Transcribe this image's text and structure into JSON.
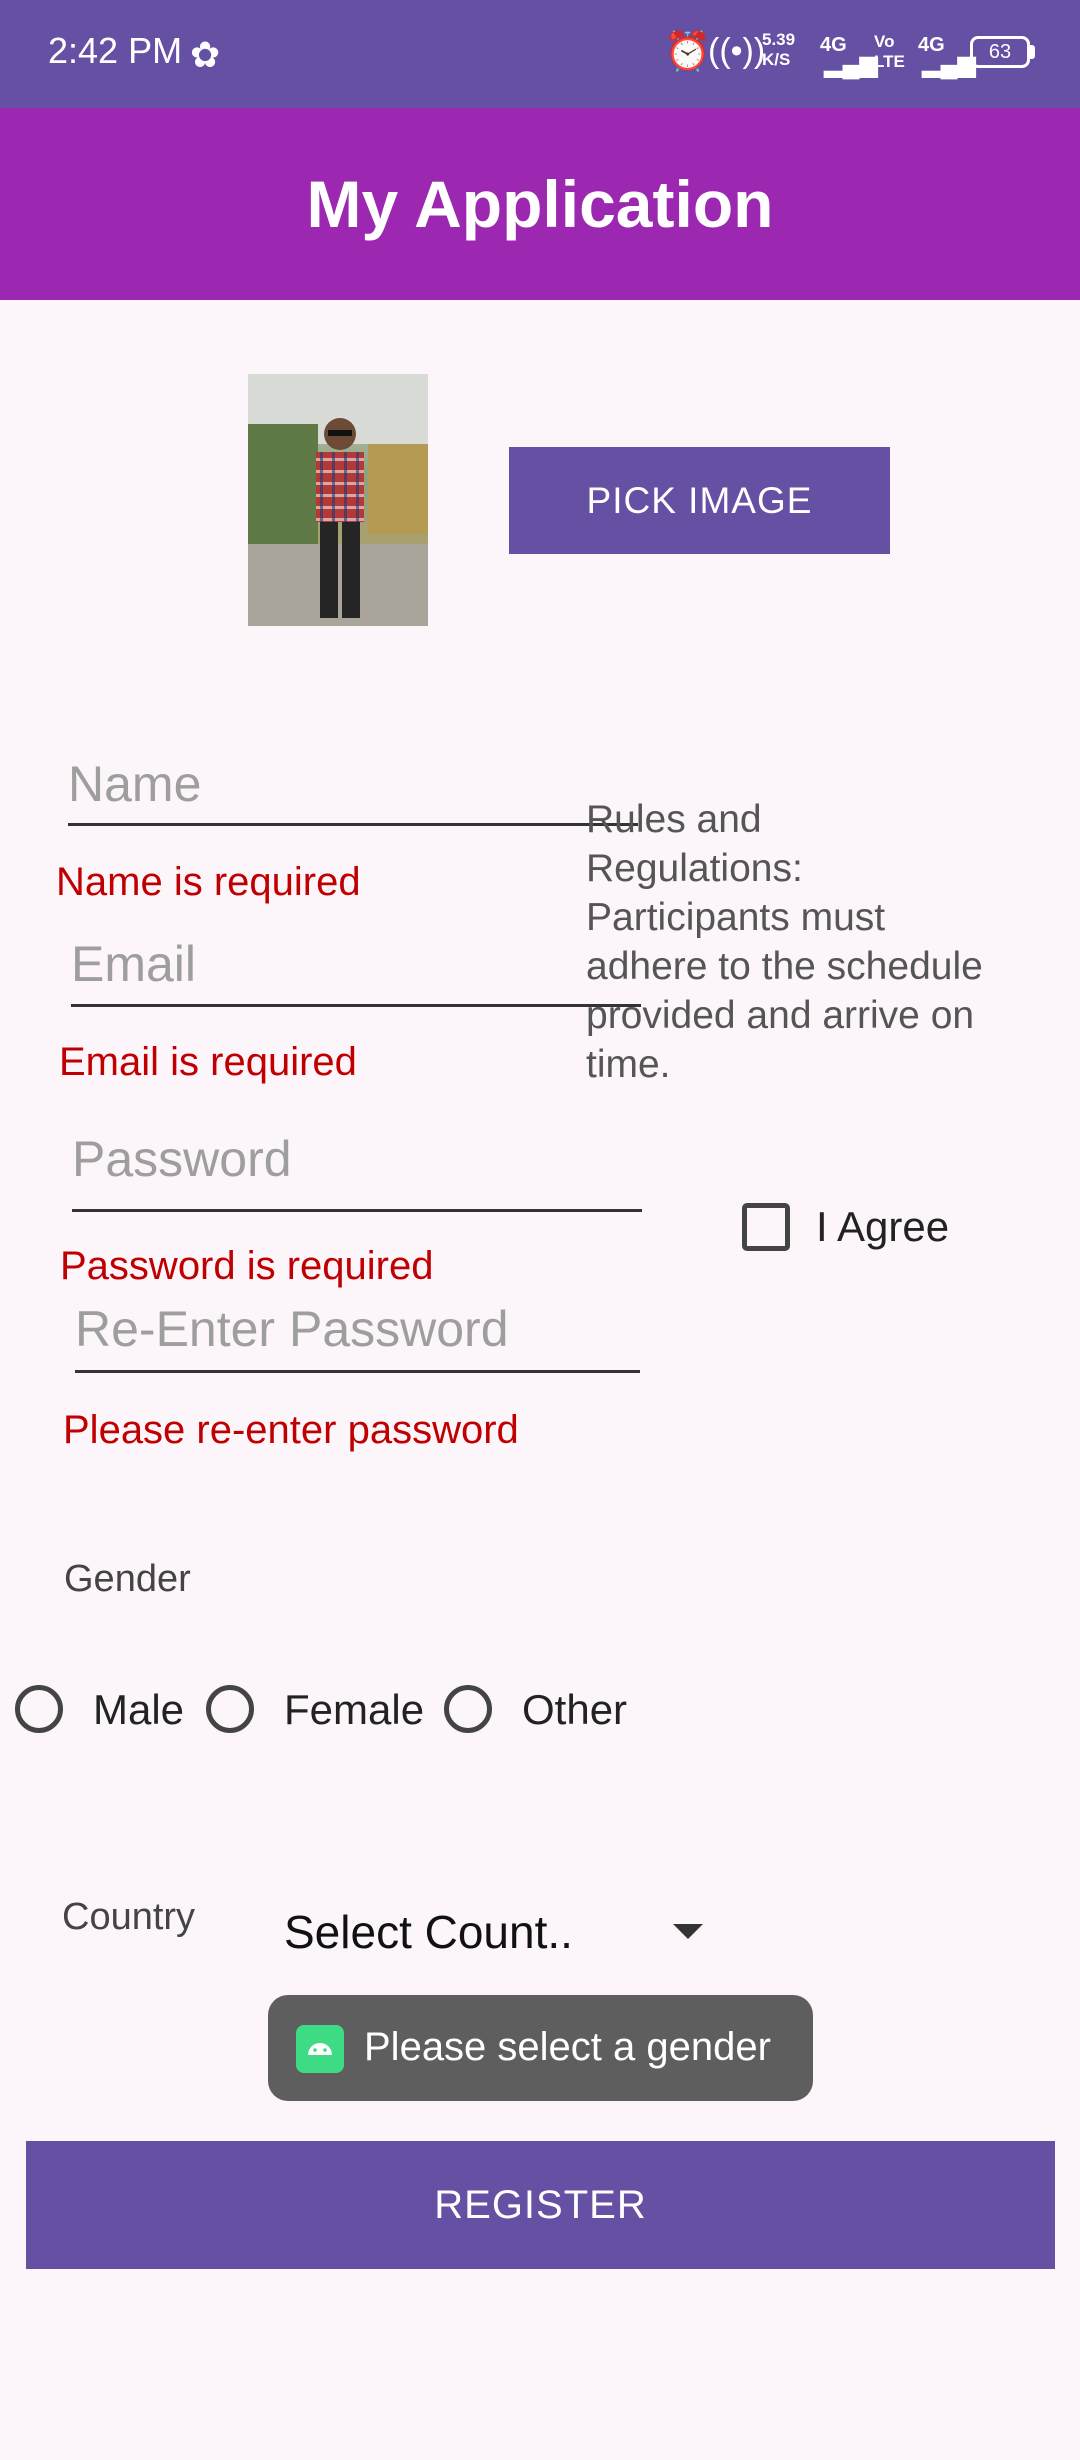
{
  "status_bar": {
    "time": "2:42 PM",
    "icons": [
      "settings-icon",
      "alarm-icon",
      "hotspot-icon",
      "speed-text",
      "signal-4g-icon",
      "volte-icon",
      "signal-4g-icon"
    ],
    "speed": "5.39 K/S",
    "network1": "4G",
    "volte": "Vo LTE",
    "network2": "4G",
    "battery": "63"
  },
  "app_bar": {
    "title": "My Application"
  },
  "profile": {
    "pick_image_label": "PICK IMAGE"
  },
  "form": {
    "name_placeholder": "Name",
    "name_error": "Name is required",
    "email_placeholder": "Email",
    "email_error": "Email is required",
    "password_placeholder": "Password",
    "password_error": "Password is required",
    "reenter_placeholder": "Re-Enter Password",
    "reenter_error": "Please re-enter password"
  },
  "rules": {
    "text": "Rules and Regulations: Participants must adhere to the schedule provided and arrive on time."
  },
  "agree": {
    "label": "I Agree"
  },
  "gender": {
    "label": "Gender",
    "options": [
      "Male",
      "Female",
      "Other"
    ]
  },
  "country": {
    "label": "Country",
    "selected": "Select Count.."
  },
  "toast": {
    "message": "Please select a gender"
  },
  "register": {
    "label": "REGISTER"
  },
  "colors": {
    "primary": "#6650a4",
    "app_bar": "#9c27b0",
    "error": "#c00000",
    "background": "#fcf6fb"
  }
}
